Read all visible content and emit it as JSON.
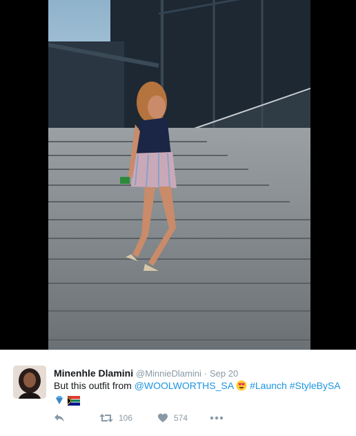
{
  "tweet": {
    "author_name": "Minenhle Dlamini",
    "handle": "@MinnieDlamini",
    "separator": "·",
    "date": "Sep 20",
    "text_intro": "But this outfit from",
    "mention": "@WOOLWORTHS_SA",
    "hashtag_launch": "#Launch",
    "hashtag_style": "#StyleBySA",
    "emojis": [
      "heart-eyes-emoji",
      "diamond-emoji",
      "south-africa-flag-emoji"
    ]
  },
  "actions": {
    "reply_icon": "reply-icon",
    "retweet_icon": "retweet-icon",
    "retweet_count": "106",
    "like_icon": "heart-icon",
    "like_count": "574",
    "more_icon": "more-dots-icon"
  },
  "colors": {
    "link": "#1b95e0",
    "muted": "#8899a6",
    "text": "#14171a"
  }
}
